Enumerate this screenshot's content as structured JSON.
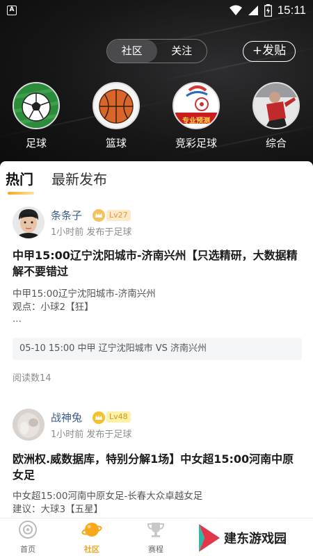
{
  "status_bar": {
    "time": "15:11",
    "left_badge": "A"
  },
  "segment": {
    "tabs": [
      "社区",
      "关注"
    ],
    "active": 0
  },
  "post_button_label": "+发贴",
  "categories": [
    {
      "label": "足球",
      "icon": "soccer-ball-icon"
    },
    {
      "label": "篮球",
      "icon": "basketball-icon"
    },
    {
      "label": "竞彩足球",
      "icon": "lottery-soccer-icon",
      "badge_text": "专业预测"
    },
    {
      "label": "综合",
      "icon": "comprehensive-icon"
    }
  ],
  "feed_tabs": [
    "热门",
    "最新发布"
  ],
  "posts": [
    {
      "username": "条条子",
      "level": "Lv27",
      "meta": "1小时前 发布于足球",
      "title": "中甲15:00辽宁沈阳城市-济南兴州【只选精研，大数据精解不要错过",
      "body_lines": [
        "中甲15:00辽宁沈阳城市-济南兴州",
        "观点：小球2【狂】",
        "..."
      ],
      "match": "05-10 15:00 中甲 辽宁沈阳城市 VS 济南兴州",
      "reads": "阅读数14"
    },
    {
      "username": "战神兔",
      "level": "Lv48",
      "meta": "1小时前 发布于足球",
      "title": "欧洲权.威数据库，特别分解1场】中女超15:00河南中原女足",
      "body_lines": [
        "中女超15:00河南中原女足-长春大众卓越女足",
        "建议：大球3【五星】"
      ]
    }
  ],
  "bottom_nav": [
    {
      "label": "首页",
      "icon": "home-icon"
    },
    {
      "label": "社区",
      "icon": "community-planet-icon",
      "active": true
    },
    {
      "label": "赛程",
      "icon": "trophy-icon"
    }
  ],
  "watermark": "建东游戏园",
  "colors": {
    "accent": "#f3a21a",
    "username": "#3a5a8a",
    "header_bg": "#161617"
  }
}
